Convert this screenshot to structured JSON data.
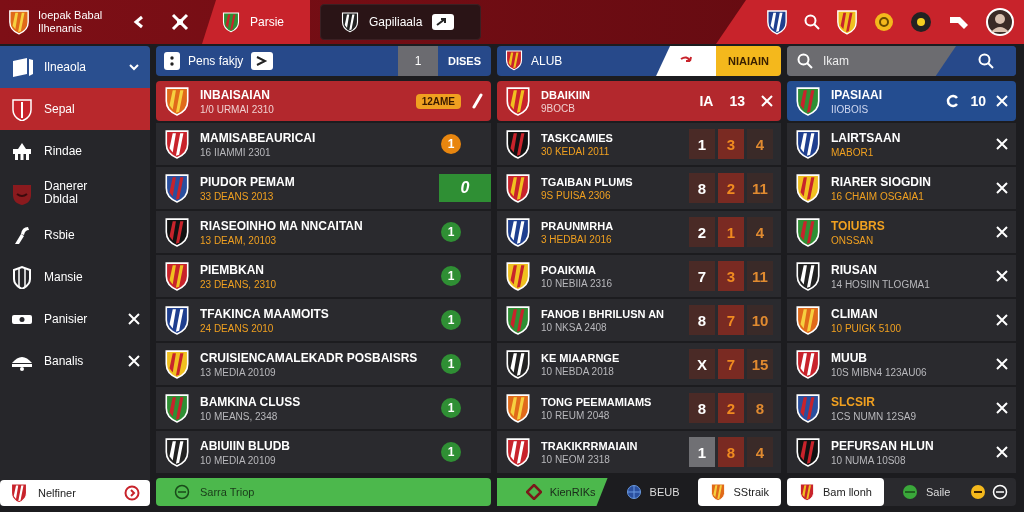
{
  "top_bar": {
    "brand": {
      "title": "Ioepak Babal",
      "subtitle": "Ilhenanis"
    },
    "tabs": [
      {
        "label": "Parsie",
        "selected": true
      },
      {
        "label": "Gapiliaala",
        "selected": false
      }
    ]
  },
  "sidebar": {
    "group": {
      "label": "Ilneaola",
      "expanded": true
    },
    "items": [
      {
        "label": "Sepal",
        "selected": true,
        "closable": false
      },
      {
        "label": "Rindae",
        "selected": false,
        "closable": false
      },
      {
        "label": "Danerer\nDbldal",
        "selected": false,
        "closable": false
      },
      {
        "label": "Rsbie",
        "selected": false,
        "closable": false
      },
      {
        "label": "Mansie",
        "selected": false,
        "closable": false
      },
      {
        "label": "Panisier",
        "selected": false,
        "closable": true
      },
      {
        "label": "Banalis",
        "selected": false,
        "closable": true
      }
    ],
    "footer": {
      "label": "Nelfiner"
    }
  },
  "fixtures": {
    "header": {
      "title": "Pens fakjy",
      "count": "1",
      "action": "DISES"
    },
    "featured": {
      "name": "INBAISAIAN",
      "sub": "1/0 URMAI 2310",
      "badge": "12AME"
    },
    "rows": [
      {
        "name": "MAMISABEAURICAI",
        "sub": "16 IIAMMI 2301",
        "sub_accent": false,
        "badge": {
          "kind": "dot",
          "value": "1",
          "color": "#e8860f"
        }
      },
      {
        "name": "PIUDOR PEMAM",
        "sub": "33 DEANS 2013",
        "sub_accent": true,
        "badge": {
          "kind": "box",
          "value": "0",
          "color": "#2f8f34"
        }
      },
      {
        "name": "RIASEOINHO MA NNCAITAN",
        "sub": "13 DEAM, 20103",
        "sub_accent": true,
        "badge": {
          "kind": "dot",
          "value": "1",
          "color": "#2f8f34"
        }
      },
      {
        "name": "PIEMBKAN",
        "sub": "23 DEANS, 2310",
        "sub_accent": true,
        "badge": {
          "kind": "dot",
          "value": "1",
          "color": "#2f8f34"
        }
      },
      {
        "name": "TFAKINCA MAAMOITS",
        "sub": "24 DEANS 2010",
        "sub_accent": true,
        "badge": {
          "kind": "dot",
          "value": "1",
          "color": "#2f8f34"
        }
      },
      {
        "name": "CRUISIENCAMALEKADR POSBAISRS",
        "sub": "13 MEDIA 20109",
        "sub_accent": false,
        "badge": {
          "kind": "dot",
          "value": "1",
          "color": "#2f8f34"
        }
      },
      {
        "name": "BAMKINA CLUSS",
        "sub": "10 MEANS, 2348",
        "sub_accent": false,
        "badge": {
          "kind": "dot",
          "value": "1",
          "color": "#2f8f34"
        }
      },
      {
        "name": "ABIUIIN BLUDB",
        "sub": "10 MEDIA 20109",
        "sub_accent": false,
        "badge": {
          "kind": "dot",
          "value": "1",
          "color": "#2f8f34"
        }
      }
    ],
    "footer": {
      "label": "Sarra Triop"
    }
  },
  "results": {
    "header": {
      "title": "ALUB",
      "action": "NIAIAIN"
    },
    "featured": {
      "name": "DBAIKIIN",
      "sub": "9BOCB",
      "stat_1": "IA",
      "stat_2": "13"
    },
    "rows": [
      {
        "name": "TASKCAMIES",
        "sub": "30 KEDAI 2011",
        "sub_accent": true,
        "scores": [
          "1",
          "3",
          "4"
        ],
        "dimmed": false
      },
      {
        "name": "TGAIBAN PLUMS",
        "sub": "9S PUISA 2306",
        "sub_accent": true,
        "scores": [
          "8",
          "2",
          "11"
        ],
        "dimmed": false
      },
      {
        "name": "PRAUNMRHA",
        "sub": "3 HEDBAI 2016",
        "sub_accent": true,
        "scores": [
          "2",
          "1",
          "4"
        ],
        "dimmed": false
      },
      {
        "name": "POAIKMIA",
        "sub": "10 NEBIIA 2316",
        "sub_accent": false,
        "scores": [
          "7",
          "3",
          "11"
        ],
        "dimmed": false
      },
      {
        "name": "FANOB I BHRILUSN AN",
        "sub": "10 NKSA 2408",
        "sub_accent": false,
        "scores": [
          "8",
          "7",
          "10"
        ],
        "dimmed": false
      },
      {
        "name": "KE MIAARNGE",
        "sub": "10 NEBDA 2018",
        "sub_accent": false,
        "scores": [
          "X",
          "7",
          "15"
        ],
        "dimmed": false
      },
      {
        "name": "TONG PEEMAMIAMS",
        "sub": "10 REUM 2048",
        "sub_accent": false,
        "scores": [
          "8",
          "2",
          "8"
        ],
        "dimmed": false
      },
      {
        "name": "TRAKIKRRMAIAIN",
        "sub": "10 NEOM 2318",
        "sub_accent": false,
        "scores": [
          "1",
          "8",
          "4"
        ],
        "dimmed": true
      }
    ],
    "footer": [
      {
        "label": "KienRIKs",
        "kind": "primary"
      },
      {
        "label": "BEUB",
        "kind": "plain"
      },
      {
        "label": "SStraik",
        "kind": "card"
      }
    ]
  },
  "clubs": {
    "search": {
      "placeholder": "Ikam"
    },
    "featured": {
      "name": "IPASIAAI",
      "sub": "IIOBOIS",
      "count": "10"
    },
    "rows": [
      {
        "name": "LAIRTSAAN",
        "sub": "MABOR1",
        "name_accent": false,
        "sub_accent": true
      },
      {
        "name": "RIARER SIOGDIN",
        "sub": "16 CHAIM OSGAIA1",
        "name_accent": false,
        "sub_accent": true
      },
      {
        "name": "TOIUBRS",
        "sub": "ONSSAN",
        "name_accent": true,
        "sub_accent": true
      },
      {
        "name": "RIUSAN",
        "sub": "14 HOSIIN TLOGMA1",
        "name_accent": false,
        "sub_accent": false
      },
      {
        "name": "CLIMAN",
        "sub": "10 PUIGK 5100",
        "name_accent": false,
        "sub_accent": true
      },
      {
        "name": "MUUB",
        "sub": "10S MIBN4 123AU06",
        "name_accent": false,
        "sub_accent": false
      },
      {
        "name": "SLCSIR",
        "sub": "1CS NUMN 12SA9",
        "name_accent": true,
        "sub_accent": false
      },
      {
        "name": "PEFURSAN HLUN",
        "sub": "10 NUMA 10S08",
        "name_accent": false,
        "sub_accent": false
      }
    ],
    "footer": [
      {
        "label": "Bam llonh",
        "kind": "card"
      },
      {
        "label": "Saile",
        "kind": "plain"
      }
    ]
  }
}
